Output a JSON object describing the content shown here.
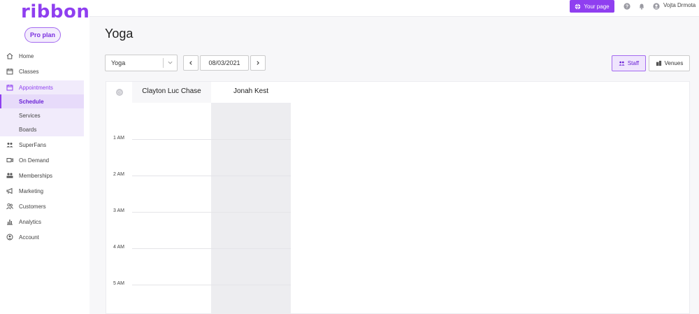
{
  "app": {
    "logo": "ribbon",
    "plan_label": "Pro plan",
    "brand_color": "#8f3ff0"
  },
  "sidebar": {
    "items": [
      {
        "label": "Home",
        "icon": "home-icon"
      },
      {
        "label": "Classes",
        "icon": "calendar-icon"
      },
      {
        "label": "Appointments",
        "icon": "appointment-calendar-icon",
        "active": true
      },
      {
        "label": "SuperFans",
        "icon": "superfans-icon"
      },
      {
        "label": "On Demand",
        "icon": "video-icon"
      },
      {
        "label": "Memberships",
        "icon": "members-icon"
      },
      {
        "label": "Marketing",
        "icon": "megaphone-icon"
      },
      {
        "label": "Customers",
        "icon": "customers-icon"
      },
      {
        "label": "Analytics",
        "icon": "analytics-icon"
      },
      {
        "label": "Account",
        "icon": "account-icon"
      }
    ],
    "sub_items": [
      {
        "label": "Schedule",
        "active": true
      },
      {
        "label": "Services"
      },
      {
        "label": "Boards"
      }
    ]
  },
  "topbar": {
    "your_page_label": "Your page",
    "user_name": "Vojta Drmota"
  },
  "main": {
    "title": "Yoga",
    "service_select": {
      "value": "Yoga"
    },
    "date": "08/03/2021",
    "prev_label": "‹",
    "next_label": "›",
    "view_toggle": {
      "staff_label": "Staff",
      "venues_label": "Venues",
      "selected": "Staff"
    }
  },
  "calendar": {
    "staff": [
      "Clayton Luc Chase",
      "Jonah Kest"
    ],
    "hours": [
      "1 AM",
      "2 AM",
      "3 AM",
      "4 AM",
      "5 AM"
    ]
  }
}
